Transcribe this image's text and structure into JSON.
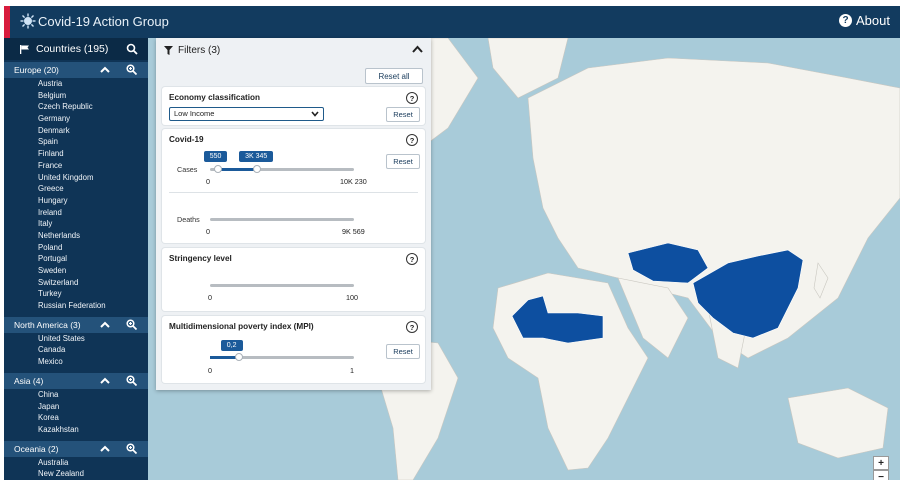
{
  "app": {
    "title": "Covid-19 Action Group",
    "about_label": "About"
  },
  "sidebar": {
    "header_label": "Countries (195)",
    "groups": [
      {
        "label": "Europe (20)",
        "countries": [
          "Austria",
          "Belgium",
          "Czech Republic",
          "Germany",
          "Denmark",
          "Spain",
          "Finland",
          "France",
          "United Kingdom",
          "Greece",
          "Hungary",
          "Ireland",
          "Italy",
          "Netherlands",
          "Poland",
          "Portugal",
          "Sweden",
          "Switzerland",
          "Turkey",
          "Russian Federation"
        ]
      },
      {
        "label": "North America (3)",
        "countries": [
          "United States",
          "Canada",
          "Mexico"
        ]
      },
      {
        "label": "Asia (4)",
        "countries": [
          "China",
          "Japan",
          "Korea",
          "Kazakhstan"
        ]
      },
      {
        "label": "Oceania (2)",
        "countries": [
          "Australia",
          "New Zealand"
        ]
      }
    ]
  },
  "filters": {
    "header_label": "Filters (3)",
    "reset_all_label": "Reset all",
    "economy": {
      "title": "Economy classification",
      "selected": "Low Income",
      "reset_label": "Reset"
    },
    "covid": {
      "title": "Covid-19",
      "reset_label": "Reset",
      "cases": {
        "label": "Cases",
        "low": "550",
        "high": "3K 345",
        "min": "0",
        "max": "10K 230",
        "low_value": 550,
        "high_value": 3345,
        "max_value": 10230
      },
      "deaths": {
        "label": "Deaths",
        "min": "0",
        "max": "9K 569"
      }
    },
    "stringency": {
      "title": "Stringency level",
      "min": "0",
      "max": "100"
    },
    "mpi": {
      "title": "Multidimensional poverty index (MPI)",
      "value": "0,2",
      "min": "0",
      "max": "1",
      "reset_label": "Reset",
      "level": 0.2
    },
    "help_glyph": "?"
  },
  "map": {
    "highlight_color": "#0d4fa0",
    "highlighted_regions": [
      "China",
      "Kazakhstan",
      "Mongolia",
      "Algeria",
      "Libya",
      "Tunisia",
      "Egypt"
    ],
    "zoom_in_label": "+",
    "zoom_out_label": "−"
  },
  "colors": {
    "topbar": "#123b5f",
    "sidebar": "#0f3456",
    "group_header": "#24527a",
    "accent": "#1b5a9a",
    "ocean": "#a8cbd9",
    "land": "#f4f3ee",
    "brand_bar": "#d81b3c"
  }
}
